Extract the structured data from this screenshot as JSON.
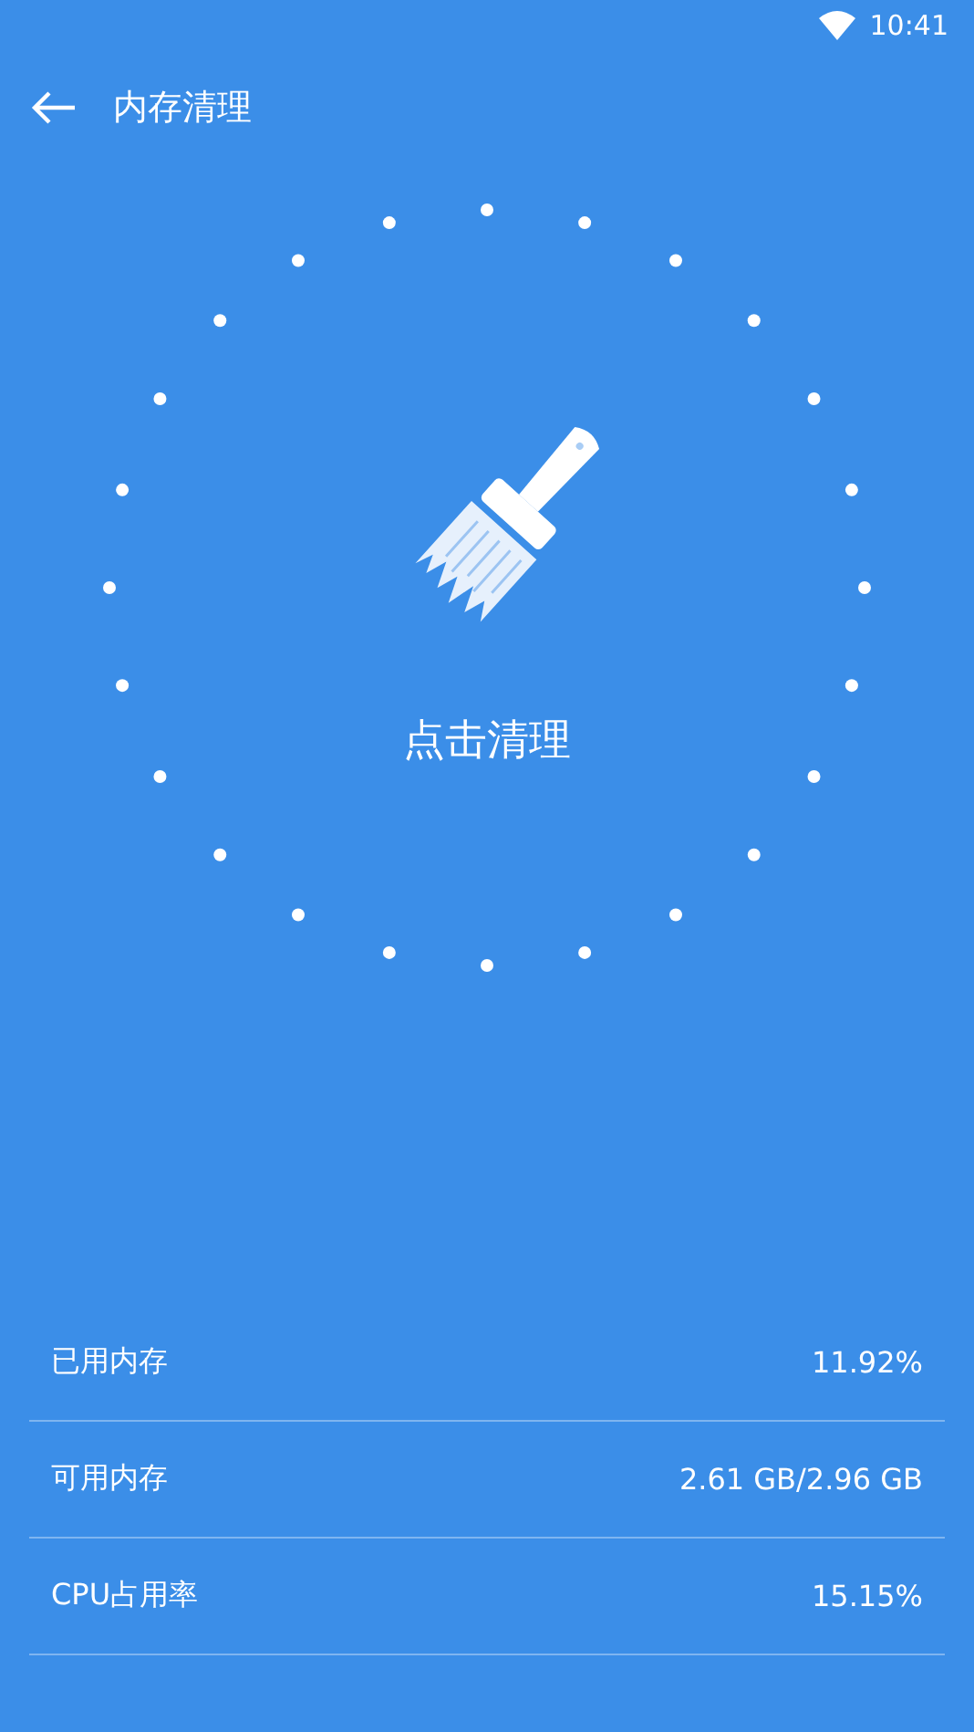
{
  "status_bar": {
    "time": "10:41"
  },
  "header": {
    "title": "内存清理"
  },
  "action": {
    "label": "点击清理"
  },
  "stats": [
    {
      "label": "已用内存",
      "value": "11.92%"
    },
    {
      "label": "可用内存",
      "value": "2.61 GB/2.96 GB"
    },
    {
      "label": "CPU占用率",
      "value": "15.15%"
    }
  ]
}
